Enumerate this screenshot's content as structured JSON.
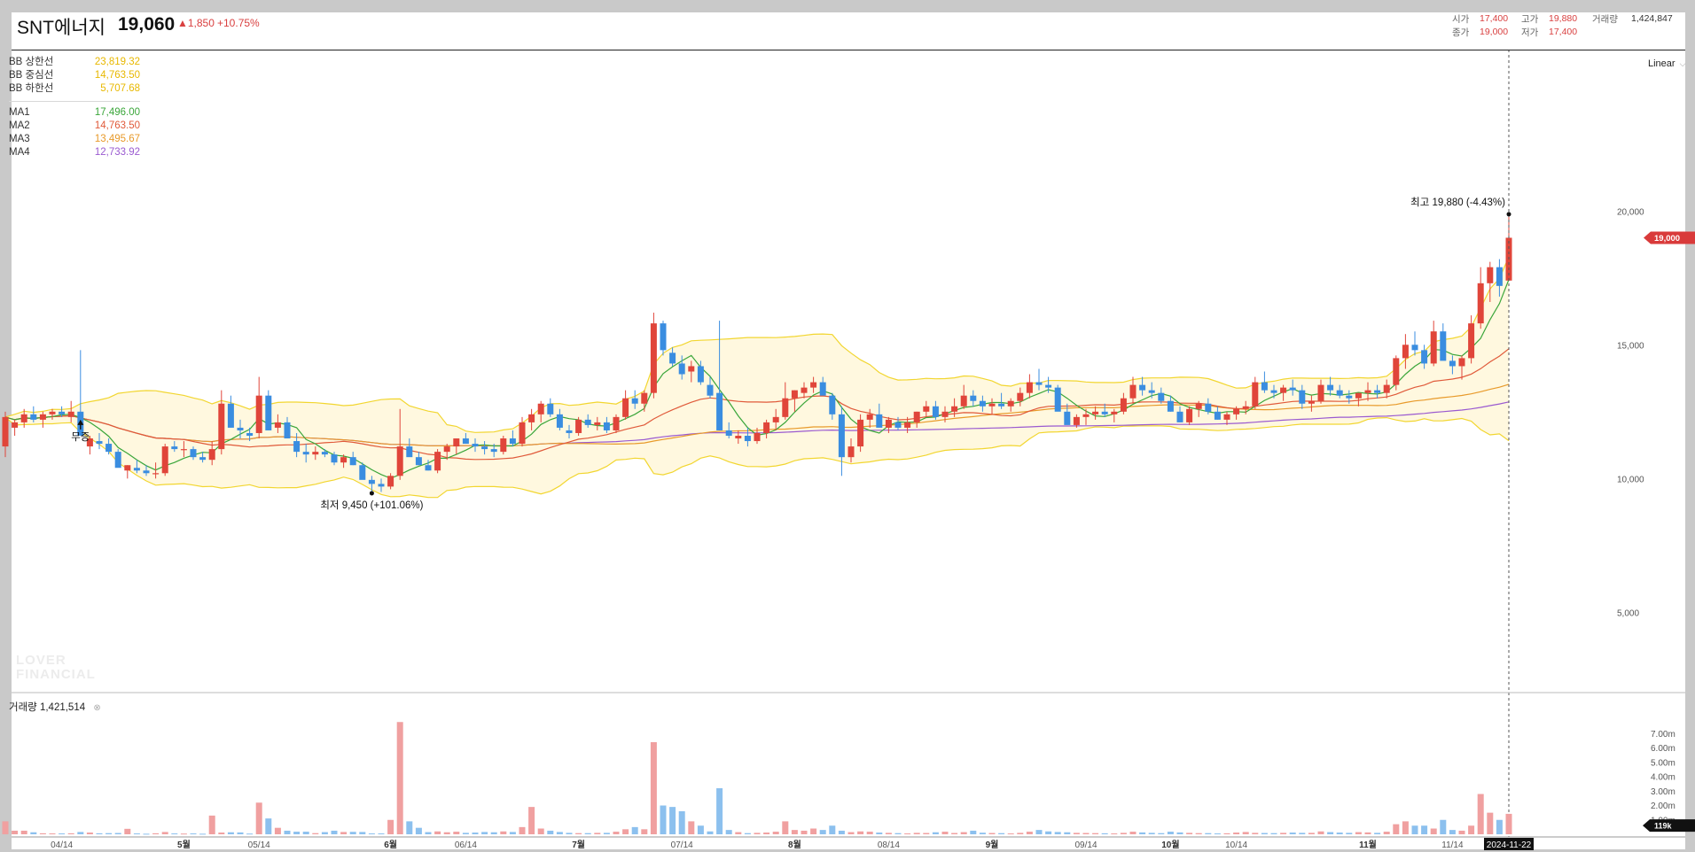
{
  "header": {
    "name": "SNT에너지",
    "price": "19,060",
    "change": "▲1,850",
    "change_pct": "+10.75%",
    "quote": {
      "open_label": "시가",
      "open": "17,400",
      "high_label": "고가",
      "high": "19,880",
      "volume_label": "거래량",
      "volume": "1,424,847",
      "close_label": "종가",
      "close": "19,000",
      "low_label": "저가",
      "low": "17,400"
    }
  },
  "legend": [
    {
      "label": "BB 상한선",
      "value": "23,819.32",
      "color": "#e8b800"
    },
    {
      "label": "BB 중심선",
      "value": "14,763.50",
      "color": "#e8b800"
    },
    {
      "label": "BB 하한선",
      "value": "5,707.68",
      "color": "#e8b800"
    },
    {
      "label": "MA1",
      "value": "17,496.00",
      "color": "#3aa63a"
    },
    {
      "label": "MA2",
      "value": "14,763.50",
      "color": "#e05a3a"
    },
    {
      "label": "MA3",
      "value": "13,495.67",
      "color": "#e89a2a"
    },
    {
      "label": "MA4",
      "value": "12,733.92",
      "color": "#9a5ad0"
    }
  ],
  "scale_selector": "Linear",
  "volume_legend": {
    "label": "거래량",
    "value": "1,421,514"
  },
  "watermark": "LOVER\nFINANCIAL",
  "colors": {
    "up": "#e0453a",
    "down": "#3a8de0",
    "vol_up": "#f0a0a0",
    "vol_down": "#8cc0ee",
    "bb": "#f2d630",
    "bb_fill": "#fff8df",
    "price_tag": "#d93a3a"
  },
  "chart_data": {
    "type": "candlestick",
    "x_labels": [
      {
        "label": "04/14",
        "i": 6,
        "bold": false
      },
      {
        "label": "5월",
        "i": 19,
        "bold": true
      },
      {
        "label": "05/14",
        "i": 27,
        "bold": false
      },
      {
        "label": "6월",
        "i": 41,
        "bold": true
      },
      {
        "label": "06/14",
        "i": 49,
        "bold": false
      },
      {
        "label": "7월",
        "i": 61,
        "bold": true
      },
      {
        "label": "07/14",
        "i": 72,
        "bold": false
      },
      {
        "label": "8월",
        "i": 84,
        "bold": true
      },
      {
        "label": "08/14",
        "i": 94,
        "bold": false
      },
      {
        "label": "9월",
        "i": 105,
        "bold": true
      },
      {
        "label": "09/14",
        "i": 115,
        "bold": false
      },
      {
        "label": "10월",
        "i": 124,
        "bold": true
      },
      {
        "label": "10/14",
        "i": 131,
        "bold": false
      },
      {
        "label": "11월",
        "i": 145,
        "bold": true
      },
      {
        "label": "11/14",
        "i": 154,
        "bold": false
      }
    ],
    "last_date": "2024-11-22",
    "y_ticks": [
      5000,
      10000,
      15000,
      20000
    ],
    "y_range": [
      2000,
      26000
    ],
    "current_price_tag": "19,000",
    "volume_ticks": [
      "1.00m",
      "2.00m",
      "3.00m",
      "4.00m",
      "5.00m",
      "6.00m",
      "7.00m"
    ],
    "volume_range": [
      0,
      8000000
    ],
    "volume_tag": "119k",
    "annotations": {
      "high": "최고 19,880 (-4.43%)",
      "low": "최저 9,450 (+101.06%)",
      "event": "무증"
    },
    "indicators": [
      "BB(20,2)",
      "MA1",
      "MA2",
      "MA3",
      "MA4"
    ],
    "candles": [
      [
        11200,
        12500,
        10800,
        12300,
        900000
      ],
      [
        11900,
        12200,
        11600,
        12100,
        250000
      ],
      [
        12100,
        12600,
        11900,
        12400,
        250000
      ],
      [
        12400,
        12700,
        12100,
        12200,
        140000
      ],
      [
        12200,
        12500,
        11900,
        12400,
        70000
      ],
      [
        12400,
        12600,
        12200,
        12500,
        60000
      ],
      [
        12500,
        12700,
        12300,
        12400,
        60000
      ],
      [
        12300,
        12900,
        12100,
        12500,
        70000
      ],
      [
        12500,
        14800,
        12300,
        11600,
        160000
      ],
      [
        11200,
        11600,
        10900,
        11500,
        120000
      ],
      [
        11400,
        11700,
        11100,
        11300,
        70000
      ],
      [
        11300,
        11500,
        10900,
        11000,
        80000
      ],
      [
        11000,
        11100,
        10500,
        10400,
        90000
      ],
      [
        10300,
        10500,
        10000,
        10500,
        380000
      ],
      [
        10400,
        10700,
        10200,
        10300,
        60000
      ],
      [
        10300,
        10500,
        10100,
        10200,
        40000
      ],
      [
        10200,
        10600,
        10000,
        10200,
        70000
      ],
      [
        10200,
        11300,
        10100,
        11200,
        160000
      ],
      [
        11200,
        11400,
        11000,
        11100,
        60000
      ],
      [
        11100,
        11400,
        10800,
        11100,
        50000
      ],
      [
        11100,
        11200,
        10700,
        10800,
        60000
      ],
      [
        10800,
        11000,
        10600,
        10700,
        40000
      ],
      [
        10700,
        11400,
        10500,
        11100,
        1300000
      ],
      [
        11100,
        13300,
        10900,
        12800,
        120000
      ],
      [
        12800,
        13100,
        11900,
        11900,
        140000
      ],
      [
        11900,
        12200,
        11500,
        11800,
        130000
      ],
      [
        11700,
        11900,
        11400,
        11600,
        50000
      ],
      [
        11700,
        13800,
        11500,
        13100,
        2200000
      ],
      [
        13100,
        13300,
        11800,
        11800,
        1100000
      ],
      [
        11900,
        12400,
        11700,
        12100,
        450000
      ],
      [
        12100,
        12300,
        11500,
        11500,
        250000
      ],
      [
        11400,
        11700,
        10800,
        11000,
        180000
      ],
      [
        11000,
        11300,
        10600,
        10900,
        180000
      ],
      [
        10900,
        11200,
        10700,
        11000,
        80000
      ],
      [
        11000,
        11100,
        10800,
        10900,
        150000
      ],
      [
        10900,
        11000,
        10500,
        10600,
        250000
      ],
      [
        10600,
        10900,
        10400,
        10800,
        160000
      ],
      [
        10800,
        11000,
        10500,
        10500,
        170000
      ],
      [
        10500,
        10600,
        10000,
        9950,
        160000
      ],
      [
        9950,
        10100,
        9450,
        9800,
        60000
      ],
      [
        9800,
        10000,
        9500,
        9700,
        60000
      ],
      [
        9700,
        10200,
        9600,
        10100,
        1000000
      ],
      [
        10100,
        12600,
        9950,
        11200,
        7800000
      ],
      [
        11200,
        11500,
        10900,
        10800,
        900000
      ],
      [
        10800,
        11000,
        10500,
        10500,
        450000
      ],
      [
        10500,
        10700,
        10300,
        10300,
        150000
      ],
      [
        10300,
        11100,
        10200,
        11000,
        200000
      ],
      [
        11000,
        11300,
        10700,
        11200,
        140000
      ],
      [
        11200,
        11500,
        10900,
        11500,
        180000
      ],
      [
        11500,
        11700,
        11300,
        11300,
        100000
      ],
      [
        11300,
        11500,
        11000,
        11200,
        120000
      ],
      [
        11200,
        11400,
        10900,
        11100,
        160000
      ],
      [
        11100,
        11300,
        10800,
        11000,
        140000
      ],
      [
        11000,
        11600,
        10900,
        11500,
        200000
      ],
      [
        11500,
        11800,
        11200,
        11300,
        160000
      ],
      [
        11300,
        12300,
        11200,
        12100,
        500000
      ],
      [
        12100,
        12600,
        11800,
        12400,
        1900000
      ],
      [
        12400,
        12900,
        12100,
        12800,
        400000
      ],
      [
        12800,
        13000,
        12300,
        12400,
        250000
      ],
      [
        12400,
        12600,
        11800,
        11900,
        160000
      ],
      [
        11800,
        12000,
        11500,
        11700,
        100000
      ],
      [
        11700,
        12300,
        11600,
        12200,
        80000
      ],
      [
        12200,
        12400,
        11900,
        12000,
        80000
      ],
      [
        12000,
        12300,
        11800,
        12100,
        100000
      ],
      [
        12100,
        12300,
        11700,
        11800,
        100000
      ],
      [
        11800,
        12400,
        11700,
        12300,
        180000
      ],
      [
        12300,
        13300,
        12200,
        13000,
        350000
      ],
      [
        13000,
        13300,
        12600,
        12800,
        500000
      ],
      [
        12800,
        13300,
        12500,
        13200,
        350000
      ],
      [
        13200,
        16200,
        13000,
        15800,
        6400000
      ],
      [
        15800,
        15900,
        14600,
        14800,
        2000000
      ],
      [
        14700,
        14900,
        14200,
        14300,
        1900000
      ],
      [
        14300,
        14600,
        13700,
        13900,
        1600000
      ],
      [
        14000,
        14400,
        13600,
        14200,
        900000
      ],
      [
        14200,
        14400,
        13500,
        13600,
        600000
      ],
      [
        13500,
        13800,
        13000,
        13100,
        200000
      ],
      [
        13200,
        15900,
        11800,
        11800,
        3200000
      ],
      [
        11800,
        12100,
        11500,
        11600,
        300000
      ],
      [
        11500,
        11800,
        11300,
        11600,
        150000
      ],
      [
        11600,
        11900,
        11200,
        11400,
        80000
      ],
      [
        11400,
        11900,
        11300,
        11700,
        100000
      ],
      [
        11700,
        12200,
        11500,
        12100,
        120000
      ],
      [
        12100,
        12600,
        11800,
        12300,
        180000
      ],
      [
        12300,
        13600,
        12200,
        13000,
        900000
      ],
      [
        13000,
        13300,
        12500,
        13300,
        300000
      ],
      [
        13200,
        13600,
        13000,
        13400,
        250000
      ],
      [
        13400,
        13800,
        13200,
        13600,
        400000
      ],
      [
        13600,
        13800,
        13200,
        13100,
        300000
      ],
      [
        13100,
        13200,
        12200,
        12400,
        600000
      ],
      [
        12400,
        12700,
        10100,
        10800,
        250000
      ],
      [
        10800,
        11500,
        10600,
        11200,
        150000
      ],
      [
        11200,
        12400,
        11000,
        12200,
        200000
      ],
      [
        12200,
        12600,
        11900,
        12400,
        180000
      ],
      [
        12400,
        12800,
        12000,
        11900,
        120000
      ],
      [
        11900,
        12300,
        11700,
        12200,
        100000
      ],
      [
        12100,
        12300,
        11800,
        11900,
        80000
      ],
      [
        11900,
        12300,
        11700,
        12100,
        60000
      ],
      [
        12100,
        12500,
        11900,
        12500,
        100000
      ],
      [
        12500,
        12900,
        12300,
        12700,
        90000
      ],
      [
        12700,
        12900,
        12200,
        12300,
        140000
      ],
      [
        12300,
        12700,
        12100,
        12500,
        180000
      ],
      [
        12500,
        13000,
        12300,
        12700,
        90000
      ],
      [
        12700,
        13500,
        12600,
        13100,
        150000
      ],
      [
        13100,
        13300,
        12700,
        12900,
        250000
      ],
      [
        12900,
        13100,
        12500,
        12700,
        110000
      ],
      [
        12700,
        13000,
        12400,
        12800,
        90000
      ],
      [
        12800,
        13200,
        12600,
        12700,
        80000
      ],
      [
        12700,
        13000,
        12500,
        12900,
        60000
      ],
      [
        12900,
        13400,
        12700,
        13200,
        100000
      ],
      [
        13200,
        13900,
        13000,
        13600,
        180000
      ],
      [
        13600,
        14100,
        13300,
        13500,
        300000
      ],
      [
        13500,
        13800,
        13200,
        13400,
        200000
      ],
      [
        13400,
        13500,
        12700,
        12500,
        160000
      ],
      [
        12500,
        12800,
        12100,
        12000,
        140000
      ],
      [
        12000,
        12400,
        11900,
        12300,
        100000
      ],
      [
        12300,
        12600,
        12000,
        12400,
        90000
      ],
      [
        12400,
        12700,
        12200,
        12500,
        80000
      ],
      [
        12500,
        12800,
        12300,
        12400,
        70000
      ],
      [
        12400,
        12600,
        12100,
        12500,
        60000
      ],
      [
        12500,
        13200,
        12400,
        13000,
        100000
      ],
      [
        13000,
        13800,
        12800,
        13500,
        180000
      ],
      [
        13500,
        13800,
        13100,
        13300,
        130000
      ],
      [
        13300,
        13600,
        13000,
        13200,
        100000
      ],
      [
        13200,
        13400,
        12800,
        12900,
        80000
      ],
      [
        12900,
        13100,
        12500,
        12500,
        180000
      ],
      [
        12500,
        12700,
        12100,
        12100,
        130000
      ],
      [
        12100,
        12700,
        12000,
        12600,
        100000
      ],
      [
        12600,
        12900,
        12300,
        12800,
        80000
      ],
      [
        12800,
        13000,
        12400,
        12500,
        80000
      ],
      [
        12500,
        12700,
        12200,
        12200,
        60000
      ],
      [
        12200,
        12500,
        12000,
        12400,
        70000
      ],
      [
        12400,
        12700,
        12200,
        12600,
        120000
      ],
      [
        12600,
        12900,
        12400,
        12700,
        160000
      ],
      [
        12700,
        13800,
        12600,
        13600,
        100000
      ],
      [
        13600,
        14000,
        13200,
        13300,
        90000
      ],
      [
        13300,
        13500,
        13000,
        13200,
        80000
      ],
      [
        13200,
        13500,
        12900,
        13400,
        100000
      ],
      [
        13400,
        13700,
        13100,
        13300,
        120000
      ],
      [
        13300,
        13500,
        12600,
        12800,
        100000
      ],
      [
        12800,
        13100,
        12500,
        12900,
        100000
      ],
      [
        12900,
        13700,
        12800,
        13500,
        200000
      ],
      [
        13500,
        13800,
        13100,
        13300,
        150000
      ],
      [
        13300,
        13500,
        13000,
        13100,
        120000
      ],
      [
        13100,
        13300,
        12800,
        13000,
        100000
      ],
      [
        13000,
        13200,
        12700,
        13200,
        150000
      ],
      [
        13200,
        13600,
        12900,
        13300,
        130000
      ],
      [
        13300,
        13500,
        13000,
        13200,
        100000
      ],
      [
        13200,
        13700,
        13000,
        13500,
        180000
      ],
      [
        13500,
        14600,
        13300,
        14500,
        700000
      ],
      [
        14500,
        15400,
        14100,
        15000,
        900000
      ],
      [
        15000,
        15500,
        14600,
        14800,
        600000
      ],
      [
        14800,
        15000,
        14100,
        14300,
        600000
      ],
      [
        14300,
        15900,
        14200,
        15500,
        400000
      ],
      [
        15500,
        15800,
        14500,
        14400,
        1000000
      ],
      [
        14400,
        14600,
        13900,
        14200,
        300000
      ],
      [
        14200,
        14600,
        13700,
        14500,
        250000
      ],
      [
        14500,
        16100,
        14300,
        15800,
        600000
      ],
      [
        15800,
        17900,
        15600,
        17300,
        2800000
      ],
      [
        17300,
        18100,
        16600,
        17900,
        1500000
      ],
      [
        17900,
        18200,
        16800,
        17200,
        1000000
      ],
      [
        17400,
        19880,
        17400,
        19000,
        1421514
      ]
    ]
  }
}
